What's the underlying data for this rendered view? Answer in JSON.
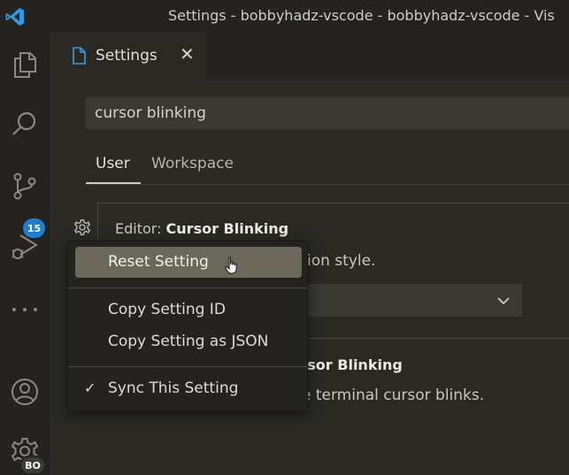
{
  "window": {
    "title": "Settings - bobbyhadz-vscode - bobbyhadz-vscode - Vis"
  },
  "activity_bar": {
    "items": [
      "explorer-icon",
      "search-icon",
      "source-control-icon",
      "run-debug-icon",
      "more-icon",
      "account-icon",
      "manage-gear-icon"
    ],
    "source_control_badge": "15",
    "account_badge": "BO"
  },
  "editor": {
    "tab": {
      "label": "Settings",
      "close": "✕"
    }
  },
  "settings": {
    "search_value": "cursor blinking",
    "scope_tabs": [
      "User",
      "Workspace"
    ],
    "active_scope": "User",
    "setting1": {
      "category": "Editor: ",
      "name": "Cursor Blinking",
      "description_visible": "ion style."
    },
    "setting2": {
      "name_visible": "ursor Blinking",
      "description_visible": "e terminal cursor blinks."
    }
  },
  "context_menu": {
    "items": [
      {
        "label": "Reset Setting",
        "highlighted": true
      },
      {
        "label": "Copy Setting ID"
      },
      {
        "label": "Copy Setting as JSON"
      },
      {
        "label": "Sync This Setting",
        "checked": true,
        "check": "✓"
      }
    ]
  },
  "colors": {
    "accent_blue": "#1f7ed1",
    "menu_highlight": "#6b675a",
    "background": "#2a2924",
    "vscode_logo": "#2f9be6"
  }
}
